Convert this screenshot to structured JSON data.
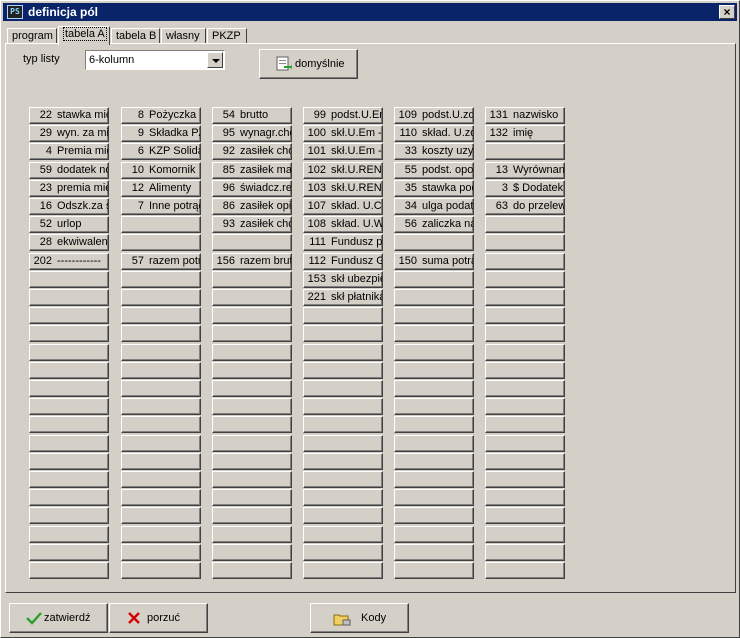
{
  "window": {
    "title": "definicja pól",
    "close_glyph": "×",
    "app_icon_text": "PS"
  },
  "tabs": [
    {
      "label": "program",
      "active": false
    },
    {
      "label": "tabela A",
      "active": true
    },
    {
      "label": "tabela B",
      "active": false
    },
    {
      "label": "własny",
      "active": false
    },
    {
      "label": "PKZP",
      "active": false
    }
  ],
  "typ_listy": {
    "label": "typ listy",
    "value": "6-kolumn"
  },
  "default_button": {
    "label": "domyślnie",
    "icon": "document-arrow-icon"
  },
  "columns": [
    [
      {
        "num": "22",
        "text": "stawka miesięczna"
      },
      {
        "num": "29",
        "text": "wyn. za miesiąc"
      },
      {
        "num": "4",
        "text": "Premia miesięczna"
      },
      {
        "num": "59",
        "text": "dodatek nocny"
      },
      {
        "num": "23",
        "text": "premia miesięczna"
      },
      {
        "num": "16",
        "text": "Odszk.za skrócenie"
      },
      {
        "num": "52",
        "text": "urlop"
      },
      {
        "num": "28",
        "text": "ekwiwalent"
      },
      {
        "num": "202",
        "text": "------------"
      }
    ],
    [
      {
        "num": "8",
        "text": "Pożyczka FŚS"
      },
      {
        "num": "9",
        "text": "Składka PZU"
      },
      {
        "num": "6",
        "text": "KZP Solidarność"
      },
      {
        "num": "10",
        "text": "Komornik"
      },
      {
        "num": "12",
        "text": "Alimenty"
      },
      {
        "num": "7",
        "text": "Inne potrącenia"
      },
      {
        "num": "",
        "text": ""
      },
      {
        "num": "",
        "text": ""
      },
      {
        "num": "57",
        "text": "razem potrącenia"
      }
    ],
    [
      {
        "num": "54",
        "text": "brutto"
      },
      {
        "num": "95",
        "text": "wynagr.chorobowe"
      },
      {
        "num": "92",
        "text": "zasiłek chorobowy"
      },
      {
        "num": "85",
        "text": "zasiłek macierzyński"
      },
      {
        "num": "96",
        "text": "świadcz.rehabilitacyjne"
      },
      {
        "num": "86",
        "text": "zasiłek opiekuńczy"
      },
      {
        "num": "93",
        "text": "zasiłek chorobowy"
      },
      {
        "num": "",
        "text": ""
      },
      {
        "num": "156",
        "text": "razem brutto"
      }
    ],
    [
      {
        "num": "99",
        "text": "podst.U.Em"
      },
      {
        "num": "100",
        "text": "skł.U.Em -"
      },
      {
        "num": "101",
        "text": "skł.U.Em -"
      },
      {
        "num": "102",
        "text": "skł.U.RENT"
      },
      {
        "num": "103",
        "text": "skł.U.RENT"
      },
      {
        "num": "107",
        "text": "skład. U.Chor"
      },
      {
        "num": "108",
        "text": "skład. U.Wyp"
      },
      {
        "num": "111",
        "text": "Fundusz pracy"
      },
      {
        "num": "112",
        "text": "Fundusz GŚP"
      },
      {
        "num": "153",
        "text": "skł ubezpieczenia"
      },
      {
        "num": "221",
        "text": "skł płatnika"
      }
    ],
    [
      {
        "num": "109",
        "text": "podst.U.zdr"
      },
      {
        "num": "110",
        "text": "skład. U.zdr"
      },
      {
        "num": "33",
        "text": "koszty uzysku"
      },
      {
        "num": "55",
        "text": "podst. opodatk"
      },
      {
        "num": "35",
        "text": "stawka podatku"
      },
      {
        "num": "34",
        "text": "ulga podatkowa"
      },
      {
        "num": "56",
        "text": "zaliczka na podatek"
      },
      {
        "num": "",
        "text": ""
      },
      {
        "num": "150",
        "text": "suma potrąceń"
      }
    ],
    [
      {
        "num": "131",
        "text": "nazwisko"
      },
      {
        "num": "132",
        "text": "imię"
      },
      {
        "num": "",
        "text": ""
      },
      {
        "num": "13",
        "text": "Wyrównanie"
      },
      {
        "num": "3",
        "text": "$ Dodatek premia"
      },
      {
        "num": "63",
        "text": "do przelewu"
      }
    ]
  ],
  "rows_per_column": 26,
  "bottom_buttons": {
    "confirm": {
      "label": "zatwierdź",
      "icon": "check-icon"
    },
    "cancel": {
      "label": "porzuć",
      "icon": "x-mark-icon"
    },
    "codes": {
      "label": "Kody",
      "icon": "folder-icon"
    }
  },
  "colors": {
    "face": "#d4d0c8",
    "title_bar": "#0a246a",
    "check_green": "#2aa02a",
    "x_red": "#d40000"
  }
}
